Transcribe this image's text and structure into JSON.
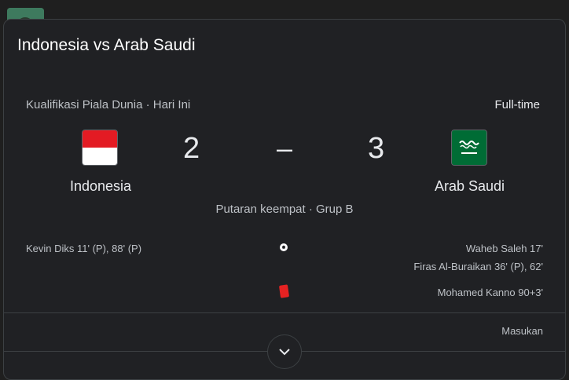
{
  "match": {
    "title": "Indonesia vs Arab Saudi",
    "competition": "Kualifikasi Piala Dunia · Hari Ini",
    "status": "Full-time",
    "round": "Putaran keempat · Grup B"
  },
  "home": {
    "name": "Indonesia",
    "score": "2",
    "goals": "Kevin Diks 11' (P), 88' (P)"
  },
  "away": {
    "name": "Arab Saudi",
    "score": "3",
    "goals": [
      "Waheb Saleh 17'",
      "Firas Al-Buraikan 36' (P), 62'"
    ],
    "red_card": "Mohamed Kanno 90+3'"
  },
  "separator": "–",
  "lineups_label": "Masukan",
  "icons": {
    "goal": "soccer-ball-icon",
    "red_card": "red-card-icon",
    "expand": "chevron-down-icon"
  },
  "colors": {
    "background": "#202124",
    "text": "#e8eaed",
    "muted": "#bdc1c6",
    "red_card": "#e52222"
  }
}
